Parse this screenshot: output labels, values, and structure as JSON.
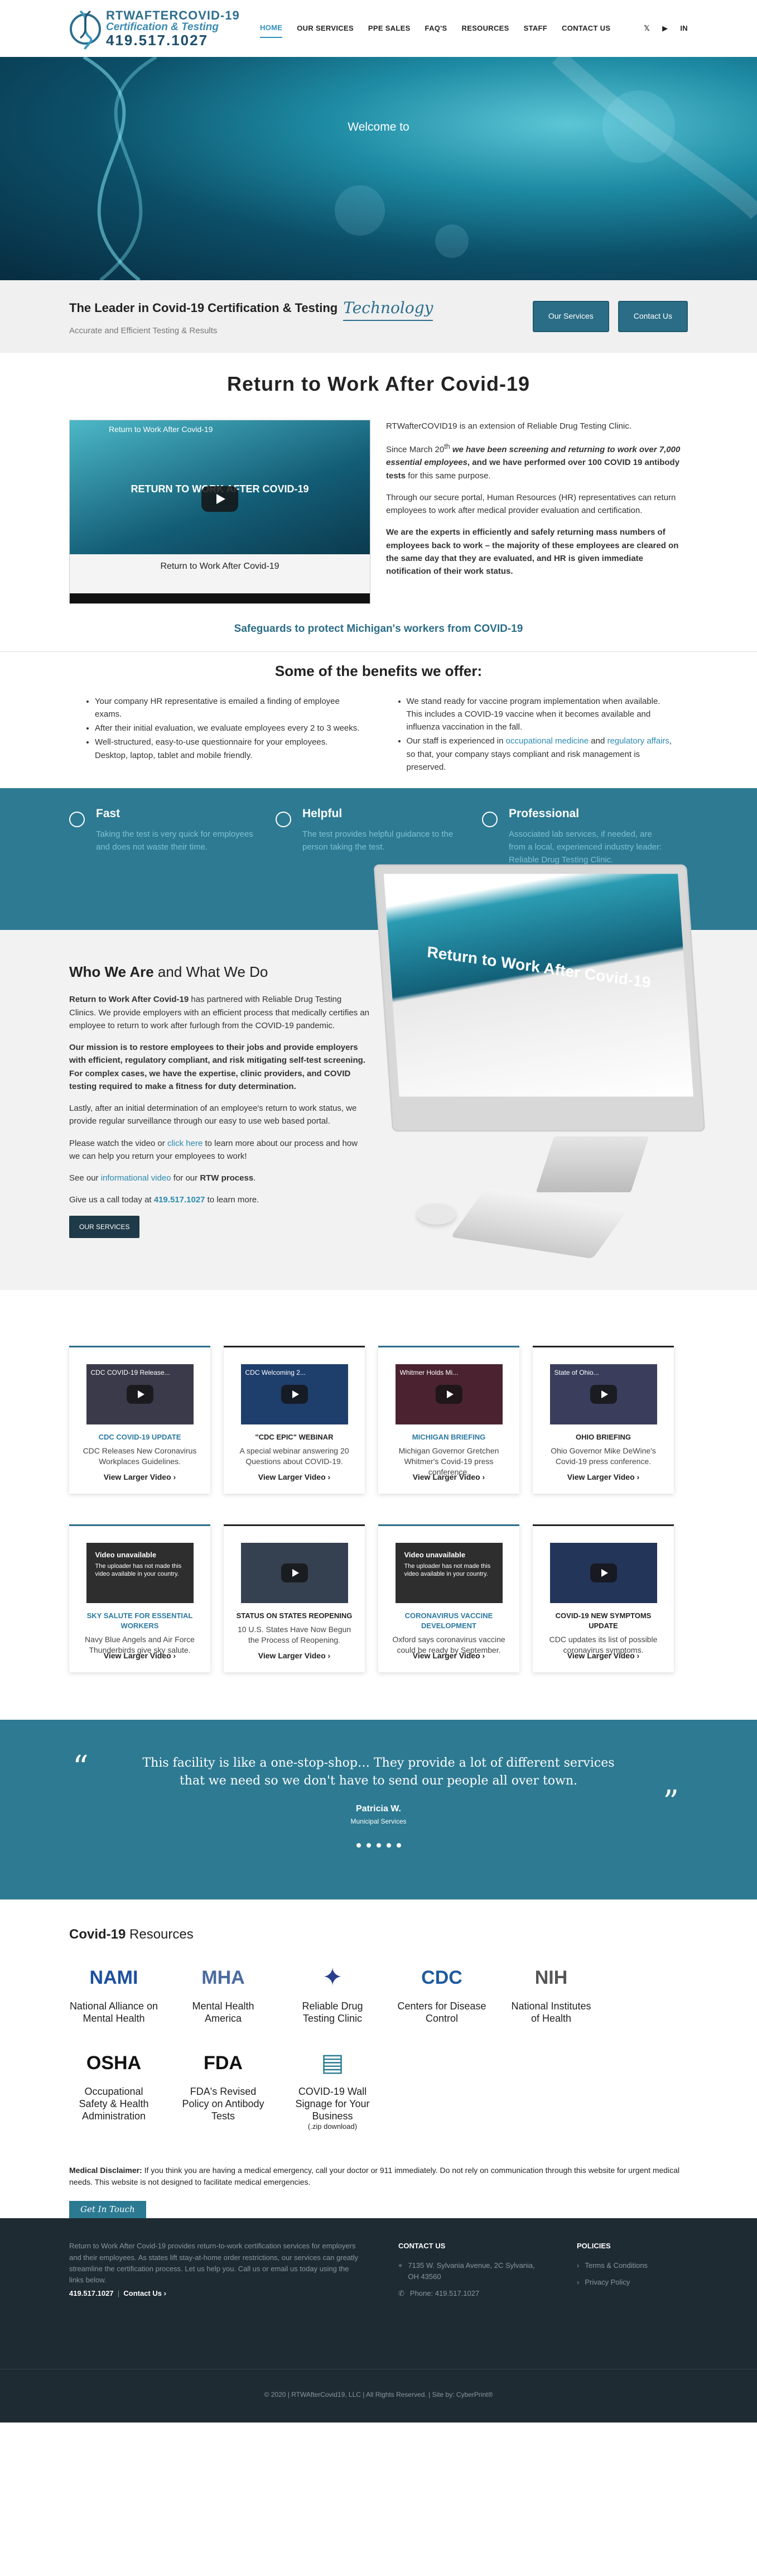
{
  "header": {
    "logo_name": "RTWAFTERCOVID-19",
    "logo_tag": "Certification & Testing",
    "logo_phone": "419.517.1027",
    "nav": [
      {
        "label": "HOME",
        "active": true
      },
      {
        "label": "OUR SERVICES",
        "active": false
      },
      {
        "label": "PPE SALES",
        "active": false
      },
      {
        "label": "FAQ'S",
        "active": false
      },
      {
        "label": "RESOURCES",
        "active": false
      },
      {
        "label": "STAFF",
        "active": false
      },
      {
        "label": "CONTACT US",
        "active": false
      }
    ],
    "social": [
      "twitter-icon",
      "youtube-icon",
      "linkedin-icon"
    ]
  },
  "hero": {
    "welcome": "Welcome to"
  },
  "leader": {
    "title": "The Leader in Covid-19 Certification & Testing",
    "tech": "Technology",
    "subtitle": "Accurate and Efficient Testing & Results",
    "btn_services": "Our Services",
    "btn_contact": "Contact Us"
  },
  "rtw": {
    "title": "Return to Work After Covid-19",
    "video_title": "Return to Work After Covid-19",
    "video_big": "RETURN TO WORK AFTER COVID-19",
    "video_caption": "Return to Work After Covid-19",
    "p1": "RTWafterCOVID19 is an extension of Reliable Drug Testing Clinic.",
    "p2a": "Since March 20",
    "p2sup": "th",
    "p2b": " we have been screening and returning to work over 7,000 essential employees",
    "p2c": ", and we have performed over 100 COVID 19 antibody tests",
    "p2d": " for this same purpose.",
    "p3": "Through our secure portal, Human Resources (HR) representatives can return employees to work after medical provider evaluation and certification.",
    "p4": "We are the experts in efficiently and safely returning mass numbers of employees back to work – the majority of these employees are cleared on the same day that they are evaluated, and HR is given immediate notification of their work status.",
    "safeguard": "Safeguards to protect Michigan's workers from COVID-19"
  },
  "benefits": {
    "title": "Some of the benefits we offer:",
    "left": [
      "Your company HR representative is emailed a finding of employee exams.",
      "After their initial evaluation, we evaluate employees every 2 to 3 weeks.",
      "Well-structured, easy-to-use questionnaire for your employees. Desktop, laptop, tablet and mobile friendly."
    ],
    "right1": "We stand ready for vaccine program implementation when available. This includes a COVID-19 vaccine when it becomes available and influenza vaccination in the fall.",
    "right2a": "Our staff is experienced in ",
    "right2link1": "occupational medicine",
    "right2and": " and ",
    "right2link2": "regulatory affairs",
    "right2b": ", so that, your company stays compliant and risk management is preserved."
  },
  "features": [
    {
      "title": "Fast",
      "text": "Taking the test is very quick for employees and does not waste their time."
    },
    {
      "title": "Helpful",
      "text": "The test provides helpful guidance to the person taking the test."
    },
    {
      "title": "Professional",
      "text": "Associated lab services, if needed, are from a local, experienced industry leader: Reliable Drug Testing Clinic."
    }
  ],
  "who": {
    "title_bold": "Who We Are",
    "title_rest": " and What We Do",
    "p1a": "Return to Work After Covid-19",
    "p1b": " has partnered with Reliable Drug Testing Clinics. We provide employers with an efficient process that medically certifies an employee to return to work after furlough from the COVID-19 pandemic.",
    "p2": "Our mission is to restore employees to their jobs and provide employers with efficient, regulatory compliant, and risk mitigating self-test screening. For complex cases, we have the expertise, clinic providers, and COVID testing required to make a fitness for duty determination.",
    "p3": "Lastly, after an initial determination of an employee's return to work status, we provide regular surveillance through our easy to use web based portal.",
    "p4a": "Please watch the video or ",
    "p4link": "click here",
    "p4b": " to learn more about our process and how we can help you return your employees to work!",
    "p5a": "See our ",
    "p5link": "informational video",
    "p5b": " for our ",
    "p5bold": "RTW process",
    "p5c": ".",
    "p6a": "Give us a call today at ",
    "p6phone": "419.517.1027",
    "p6b": " to learn more.",
    "button": "OUR SERVICES",
    "screen_text": "Return to Work After Covid-19"
  },
  "cards": [
    {
      "thumb": "CDC COVID-19 Release...",
      "title": "CDC COVID-19 UPDATE",
      "text": "CDC Releases New Coronavirus Workplaces Guidelines.",
      "link": "View Larger Video ›",
      "style": "blue",
      "bg": "#3a3a4a"
    },
    {
      "thumb": "CDC Welcoming 2...",
      "title": "\"CDC EPIC\" WEBINAR",
      "text": "A special webinar answering 20 Questions about COVID-19.",
      "link": "View Larger Video ›",
      "style": "dark",
      "bg": "#1e3e6c"
    },
    {
      "thumb": "Whitmer Holds Mi...",
      "title": "MICHIGAN BRIEFING",
      "text": "Michigan Governor Gretchen Whitmer's Covid-19 press conference.",
      "link": "View Larger Video ›",
      "style": "blue",
      "bg": "#4a2230"
    },
    {
      "thumb": "State of Ohio...",
      "title": "OHIO BRIEFING",
      "text": "Ohio Governor Mike DeWine's Covid-19 press conference.",
      "link": "View Larger Video ›",
      "style": "dark",
      "bg": "#3a3e5c"
    },
    {
      "unav": true,
      "title": "SKY SALUTE FOR ESSENTIAL WORKERS",
      "text": "Navy Blue Angels and Air Force Thunderbirds give sky salute.",
      "link": "View Larger Video ›",
      "style": "blue",
      "bg": "#2e2e2e"
    },
    {
      "thumb": "",
      "title": "STATUS ON STATES REOPENING",
      "text": "10 U.S. States Have Now Begun the Process of Reopening.",
      "link": "View Larger Video ›",
      "style": "dark",
      "bg": "#354050"
    },
    {
      "unav": true,
      "title": "CORONAVIRUS VACCINE DEVELOPMENT",
      "text": "Oxford says coronavirus vaccine could be ready by September.",
      "link": "View Larger Video ›",
      "style": "blue",
      "bg": "#2e2e2e"
    },
    {
      "thumb": "",
      "title": "COVID-19 NEW SYMPTOMS UPDATE",
      "text": "CDC updates its list of possible coronavirus symptoms.",
      "link": "View Larger Video ›",
      "style": "dark",
      "bg": "#24355a"
    }
  ],
  "unavailable": {
    "title": "Video unavailable",
    "text": "The uploader has not made this video available in your country."
  },
  "testimonial": {
    "quote": "This facility is like a one-stop-shop… They provide a lot of different services that we need so we don't have to send our people all over town.",
    "name": "Patricia W.",
    "role": "Municipal Services"
  },
  "resources": {
    "title_bold": "Covid-19",
    "title_rest": " Resources",
    "items": [
      {
        "logo": "NAMI",
        "label": "National Alliance on Mental Health",
        "color": "#1b4fa0"
      },
      {
        "logo": "MHA",
        "label": "Mental Health America",
        "color": "#4a6aa0"
      },
      {
        "logo": "✦",
        "label": "Reliable Drug Testing Clinic",
        "color": "#2a3e8c"
      },
      {
        "logo": "CDC",
        "label": "Centers for Disease Control",
        "color": "#1f5aa0"
      },
      {
        "logo": "NIH",
        "label": "National Institutes of Health",
        "color": "#555555"
      },
      {
        "logo": "OSHA",
        "label": "Occupational Safety & Health Administration",
        "color": "#111111"
      },
      {
        "logo": "FDA",
        "label": "FDA's Revised Policy on Antibody Tests",
        "color": "#111111"
      },
      {
        "logo": "▤",
        "label": "COVID-19 Wall Signage for Your Business",
        "sub": "(.zip download)",
        "color": "#2b7a92"
      }
    ]
  },
  "disclaimer": {
    "bold": "Medical Disclaimer:",
    "text": " If you think you are having a medical emergency, call your doctor or 911 immediately. Do not rely on communication through this website for urgent medical needs. This website is not designed to facilitate medical emergencies."
  },
  "touch": "Get In Touch",
  "footer": {
    "about": "Return to Work After Covid-19 provides return-to-work certification services for employers and their employees. As states lift stay-at-home order restrictions, our services can greatly streamline the certification process. Let us help you. Call us or email us today using the links below.",
    "phone": "419.517.1027",
    "contact_link": "Contact Us ›",
    "contact_title": "CONTACT US",
    "address": "7135 W. Sylvania Avenue, 2C Sylvania, OH 43560",
    "phone_label": "Phone: 419.517.1027",
    "policies_title": "POLICIES",
    "policies": [
      "Terms & Conditions",
      "Privacy Policy"
    ],
    "copyright": "© 2020 | RTWAfterCovid19, LLC | All Rights Reserved. | Site by: CyberPrint®"
  }
}
